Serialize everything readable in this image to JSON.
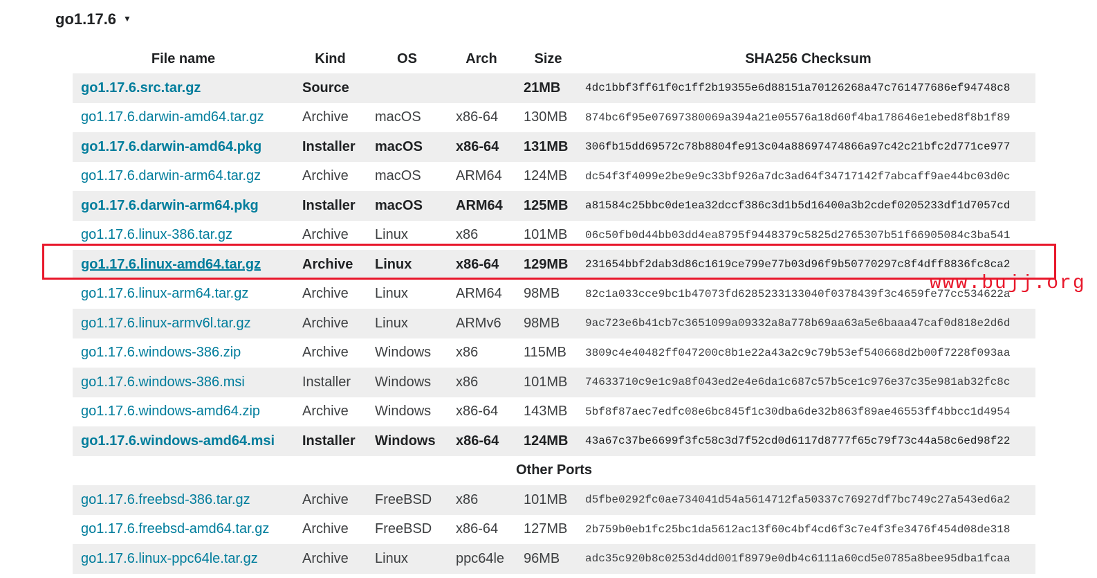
{
  "version": {
    "label": "go1.17.6",
    "caret": "▼"
  },
  "table": {
    "headers": [
      "File name",
      "Kind",
      "OS",
      "Arch",
      "Size",
      "SHA256 Checksum"
    ],
    "rows": [
      {
        "file": "go1.17.6.src.tar.gz",
        "kind": "Source",
        "os": "",
        "arch": "",
        "size": "21MB",
        "sha": "4dc1bbf3ff61f0c1ff2b19355e6d88151a70126268a47c761477686ef94748c8",
        "highlight": true
      },
      {
        "file": "go1.17.6.darwin-amd64.tar.gz",
        "kind": "Archive",
        "os": "macOS",
        "arch": "x86-64",
        "size": "130MB",
        "sha": "874bc6f95e07697380069a394a21e05576a18d60f4ba178646e1ebed8f8b1f89",
        "highlight": false
      },
      {
        "file": "go1.17.6.darwin-amd64.pkg",
        "kind": "Installer",
        "os": "macOS",
        "arch": "x86-64",
        "size": "131MB",
        "sha": "306fb15dd69572c78b8804fe913c04a88697474866a97c42c21bfc2d771ce977",
        "highlight": true
      },
      {
        "file": "go1.17.6.darwin-arm64.tar.gz",
        "kind": "Archive",
        "os": "macOS",
        "arch": "ARM64",
        "size": "124MB",
        "sha": "dc54f3f4099e2be9e9c33bf926a7dc3ad64f34717142f7abcaff9ae44bc03d0c",
        "highlight": false
      },
      {
        "file": "go1.17.6.darwin-arm64.pkg",
        "kind": "Installer",
        "os": "macOS",
        "arch": "ARM64",
        "size": "125MB",
        "sha": "a81584c25bbc0de1ea32dccf386c3d1b5d16400a3b2cdef0205233df1d7057cd",
        "highlight": true
      },
      {
        "file": "go1.17.6.linux-386.tar.gz",
        "kind": "Archive",
        "os": "Linux",
        "arch": "x86",
        "size": "101MB",
        "sha": "06c50fb0d44bb03dd4ea8795f9448379c5825d2765307b51f66905084c3ba541",
        "highlight": false
      },
      {
        "file": "go1.17.6.linux-amd64.tar.gz",
        "kind": "Archive",
        "os": "Linux",
        "arch": "x86-64",
        "size": "129MB",
        "sha": "231654bbf2dab3d86c1619ce799e77b03d96f9b50770297c8f4dff8836fc8ca2",
        "highlight": true,
        "underline": true
      },
      {
        "file": "go1.17.6.linux-arm64.tar.gz",
        "kind": "Archive",
        "os": "Linux",
        "arch": "ARM64",
        "size": "98MB",
        "sha": "82c1a033cce9bc1b47073fd6285233133040f0378439f3c4659fe77cc534622a",
        "highlight": false
      },
      {
        "file": "go1.17.6.linux-armv6l.tar.gz",
        "kind": "Archive",
        "os": "Linux",
        "arch": "ARMv6",
        "size": "98MB",
        "sha": "9ac723e6b41cb7c3651099a09332a8a778b69aa63a5e6baaa47caf0d818e2d6d",
        "highlight": false
      },
      {
        "file": "go1.17.6.windows-386.zip",
        "kind": "Archive",
        "os": "Windows",
        "arch": "x86",
        "size": "115MB",
        "sha": "3809c4e40482ff047200c8b1e22a43a2c9c79b53ef540668d2b00f7228f093aa",
        "highlight": false
      },
      {
        "file": "go1.17.6.windows-386.msi",
        "kind": "Installer",
        "os": "Windows",
        "arch": "x86",
        "size": "101MB",
        "sha": "74633710c9e1c9a8f043ed2e4e6da1c687c57b5ce1c976e37c35e981ab32fc8c",
        "highlight": false
      },
      {
        "file": "go1.17.6.windows-amd64.zip",
        "kind": "Archive",
        "os": "Windows",
        "arch": "x86-64",
        "size": "143MB",
        "sha": "5bf8f87aec7edfc08e6bc845f1c30dba6de32b863f89ae46553ff4bbcc1d4954",
        "highlight": false
      },
      {
        "file": "go1.17.6.windows-amd64.msi",
        "kind": "Installer",
        "os": "Windows",
        "arch": "x86-64",
        "size": "124MB",
        "sha": "43a67c37be6699f3fc58c3d7f52cd0d6117d8777f65c79f73c44a58c6ed98f22",
        "highlight": true
      }
    ],
    "other_ports_label": "Other Ports",
    "other_rows": [
      {
        "file": "go1.17.6.freebsd-386.tar.gz",
        "kind": "Archive",
        "os": "FreeBSD",
        "arch": "x86",
        "size": "101MB",
        "sha": "d5fbe0292fc0ae734041d54a5614712fa50337c76927df7bc749c27a543ed6a2",
        "highlight": false
      },
      {
        "file": "go1.17.6.freebsd-amd64.tar.gz",
        "kind": "Archive",
        "os": "FreeBSD",
        "arch": "x86-64",
        "size": "127MB",
        "sha": "2b759b0eb1fc25bc1da5612ac13f60c4bf4cd6f3c7e4f3fe3476f454d08de318",
        "highlight": false
      },
      {
        "file": "go1.17.6.linux-ppc64le.tar.gz",
        "kind": "Archive",
        "os": "Linux",
        "arch": "ppc64le",
        "size": "96MB",
        "sha": "adc35c920b8c0253d4dd001f8979e0db4c6111a60cd5e0785a8bee95dba1fcaa",
        "highlight": false
      }
    ]
  },
  "watermark": "www.bujj.org",
  "colors": {
    "link": "#007d9c",
    "row_stripe": "#eeeeee",
    "annotation_red": "#e8182b"
  }
}
